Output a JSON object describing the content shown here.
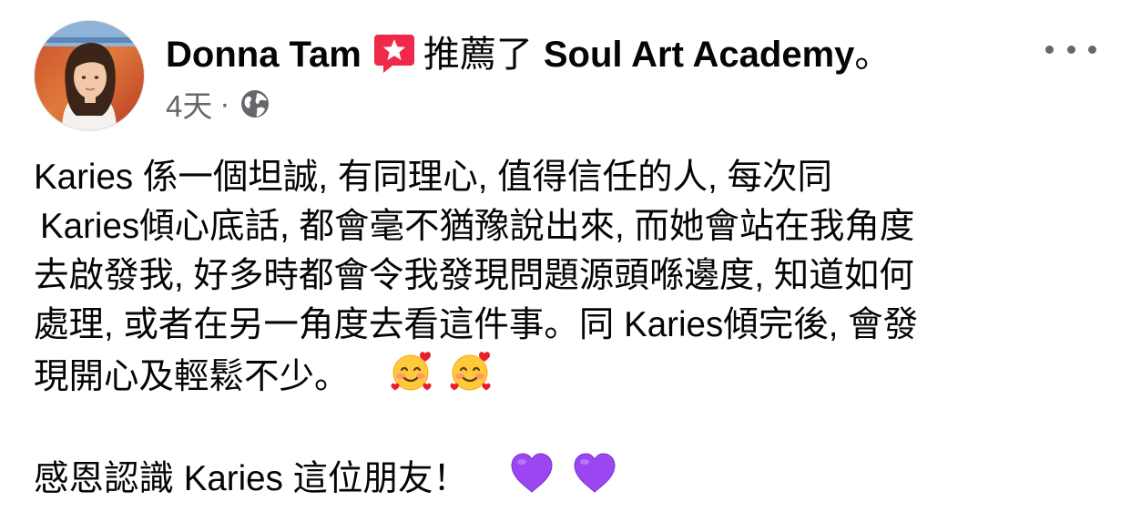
{
  "post": {
    "author": "Donna Tam",
    "action": "推薦了",
    "page_name": "Soul Art Academy",
    "end_punct": "。",
    "time": "4天",
    "separator": "·",
    "privacy_icon": "globe-icon",
    "recommend_icon": "recommend-star-badge-icon",
    "more_icon": "more-options-icon",
    "body_lines": [
      "Karies 係一個坦誠,  有同理心, 值得信任的人, 每次同",
      "Karies傾心底話, 都會毫不猶豫說出來, 而她會站在我角度",
      "去啟發我, 好多時都會令我發現問題源頭喺邊度, 知道如何",
      "處理, 或者在另一角度去看這件事。同 Karies傾完後, 會發",
      "現開心及輕鬆不少。"
    ],
    "line5_emojis": [
      "smiling-face-with-hearts",
      "smiling-face-with-hearts"
    ],
    "closing_line": "感恩認識 Karies 這位朋友！",
    "closing_emojis": [
      "purple-heart",
      "purple-heart"
    ]
  },
  "colors": {
    "primary_text": "#050505",
    "secondary_text": "#65676b",
    "recommend_badge": "#f02849",
    "purple_heart": "#9b46f0"
  }
}
